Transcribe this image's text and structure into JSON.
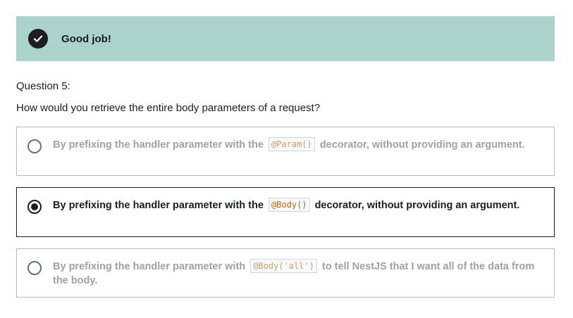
{
  "alert": {
    "message": "Good job!",
    "icon": "check-circle-icon",
    "background": "#acd2cc"
  },
  "question": {
    "number_label": "Question 5:",
    "text": "How would you retrieve the entire body parameters of a request?"
  },
  "options": [
    {
      "before": "By prefixing the handler parameter with the",
      "code": "@Param()",
      "after": "decorator, without providing an argument.",
      "selected": false
    },
    {
      "before": "By prefixing the handler parameter with the",
      "code": "@Body()",
      "after": "decorator, without providing an argument.",
      "selected": true
    },
    {
      "before": "By prefixing the handler parameter with",
      "code": "@Body('all')",
      "after": "to tell NestJS that I want all of the data from the body.",
      "selected": false
    }
  ],
  "colors": {
    "text": "#1c1d1f",
    "muted_text": "#a1a1a1",
    "code_text": "#b4690e"
  }
}
